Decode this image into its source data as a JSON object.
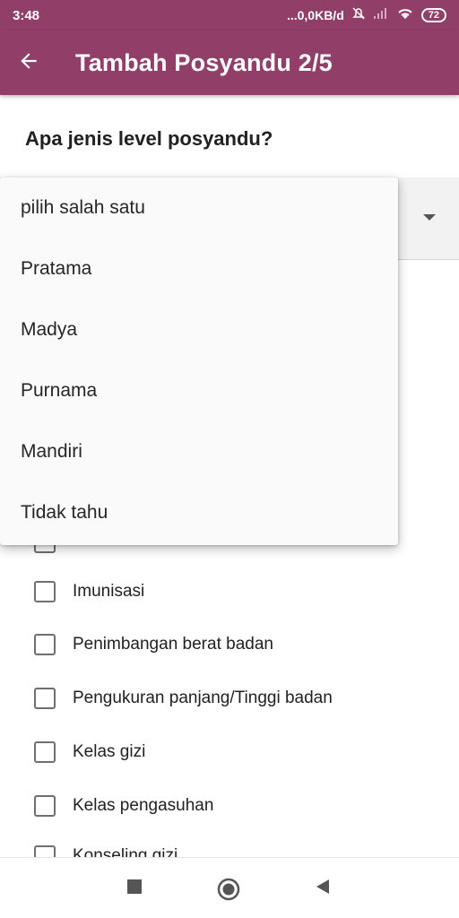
{
  "status_bar": {
    "time": "3:48",
    "network": "...0,0KB/d",
    "battery": "72"
  },
  "app_bar": {
    "title": "Tambah Posyandu 2/5"
  },
  "question": "Apa jenis level posyandu?",
  "dropdown": {
    "options": [
      "pilih salah satu",
      "Pratama",
      "Madya",
      "Purnama",
      "Mandiri",
      "Tidak tahu"
    ]
  },
  "checklist": {
    "items": [
      {
        "label": "Imunisasi",
        "checked": false
      },
      {
        "label": "Penimbangan berat badan",
        "checked": false
      },
      {
        "label": "Pengukuran panjang/Tinggi badan",
        "checked": false
      },
      {
        "label": "Kelas gizi",
        "checked": false
      },
      {
        "label": "Kelas pengasuhan",
        "checked": false
      },
      {
        "label": "Konseling gizi",
        "checked": false
      }
    ]
  },
  "colors": {
    "primary": "#913f68",
    "dropdown_bg": "#fafafa"
  },
  "icons": {
    "back": "arrow-back-icon",
    "nav_recent": "square-icon",
    "nav_home": "circle-icon",
    "nav_back": "triangle-back-icon"
  }
}
